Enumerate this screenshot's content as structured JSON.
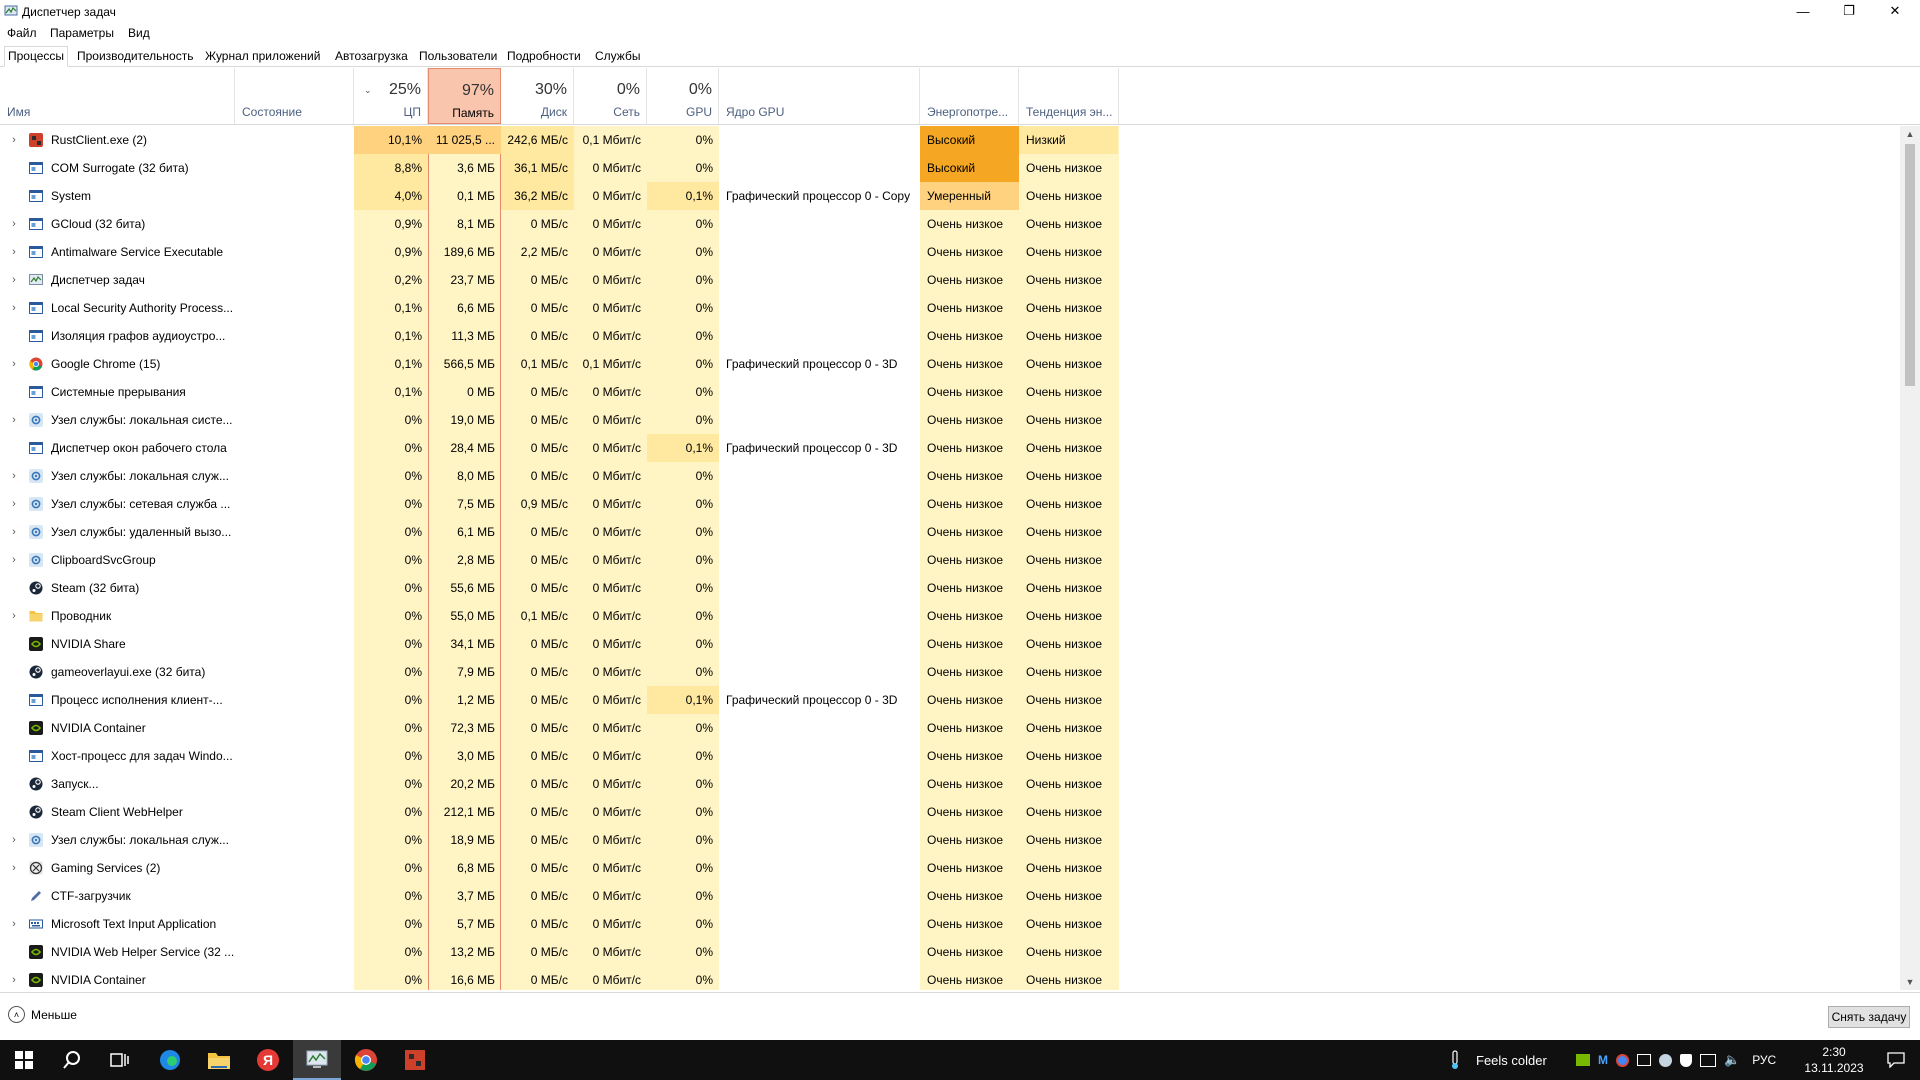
{
  "window": {
    "title": "Диспетчер задач"
  },
  "menu": [
    "Файл",
    "Параметры",
    "Вид"
  ],
  "tabs": [
    "Процессы",
    "Производительность",
    "Журнал приложений",
    "Автозагрузка",
    "Пользователи",
    "Подробности",
    "Службы"
  ],
  "header": {
    "name": "Имя",
    "status": "Состояние",
    "cpu_pct": "25%",
    "cpu": "ЦП",
    "mem_pct": "97%",
    "mem": "Память",
    "disk_pct": "30%",
    "disk": "Диск",
    "net_pct": "0%",
    "net": "Сеть",
    "gpu_pct": "0%",
    "gpu": "GPU",
    "gpu_engine": "Ядро GPU",
    "power": "Энергопотре...",
    "power_trend": "Тенденция эн..."
  },
  "colors": {
    "heat_light": "#fff4c4",
    "heat_mid": "#ffe8a0",
    "mem_heat": "#ffd27f",
    "power_high": "#f5a623",
    "power_medium": "#ffd27f",
    "mem_header": "#f9c5ad"
  },
  "rows": [
    {
      "exp": true,
      "icon": "rust-icon",
      "name": "RustClient.exe (2)",
      "cpu": "10,1%",
      "mem": "11 025,5 ...",
      "disk": "242,6 МБ/с",
      "net": "0,1 Мбит/с",
      "gpu": "0%",
      "engine": "",
      "power": "Высокий",
      "trend": "Низкий",
      "pl": "high",
      "tl": "low",
      "heat": 3
    },
    {
      "exp": false,
      "icon": "window-icon",
      "name": "COM Surrogate (32 бита)",
      "cpu": "8,8%",
      "mem": "3,6 МБ",
      "disk": "36,1 МБ/с",
      "net": "0 Мбит/с",
      "gpu": "0%",
      "engine": "",
      "power": "Высокий",
      "trend": "Очень низкое",
      "pl": "high",
      "tl": "",
      "heat": 2
    },
    {
      "exp": false,
      "icon": "window-icon",
      "name": "System",
      "cpu": "4,0%",
      "mem": "0,1 МБ",
      "disk": "36,2 МБ/с",
      "net": "0 Мбит/с",
      "gpu": "0,1%",
      "engine": "Графический процессор 0 - Copy",
      "power": "Умеренный",
      "trend": "Очень низкое",
      "pl": "mid",
      "tl": "",
      "heat": 2
    },
    {
      "exp": true,
      "icon": "window-icon",
      "name": "GCloud (32 бита)",
      "cpu": "0,9%",
      "mem": "8,1 МБ",
      "disk": "0 МБ/с",
      "net": "0 Мбит/с",
      "gpu": "0%",
      "engine": "",
      "power": "Очень низкое",
      "trend": "Очень низкое",
      "pl": "",
      "tl": "",
      "heat": 1
    },
    {
      "exp": true,
      "icon": "window-icon",
      "name": "Antimalware Service Executable",
      "cpu": "0,9%",
      "mem": "189,6 МБ",
      "disk": "2,2 МБ/с",
      "net": "0 Мбит/с",
      "gpu": "0%",
      "engine": "",
      "power": "Очень низкое",
      "trend": "Очень низкое",
      "pl": "",
      "tl": "",
      "heat": 1
    },
    {
      "exp": true,
      "icon": "taskmgr-icon",
      "name": "Диспетчер задач",
      "cpu": "0,2%",
      "mem": "23,7 МБ",
      "disk": "0 МБ/с",
      "net": "0 Мбит/с",
      "gpu": "0%",
      "engine": "",
      "power": "Очень низкое",
      "trend": "Очень низкое",
      "pl": "",
      "tl": "",
      "heat": 1
    },
    {
      "exp": true,
      "icon": "window-icon",
      "name": "Local Security Authority Process...",
      "cpu": "0,1%",
      "mem": "6,6 МБ",
      "disk": "0 МБ/с",
      "net": "0 Мбит/с",
      "gpu": "0%",
      "engine": "",
      "power": "Очень низкое",
      "trend": "Очень низкое",
      "pl": "",
      "tl": "",
      "heat": 1
    },
    {
      "exp": false,
      "icon": "window-icon",
      "name": "Изоляция графов аудиоустро...",
      "cpu": "0,1%",
      "mem": "11,3 МБ",
      "disk": "0 МБ/с",
      "net": "0 Мбит/с",
      "gpu": "0%",
      "engine": "",
      "power": "Очень низкое",
      "trend": "Очень низкое",
      "pl": "",
      "tl": "",
      "heat": 1
    },
    {
      "exp": true,
      "icon": "chrome-icon",
      "name": "Google Chrome (15)",
      "cpu": "0,1%",
      "mem": "566,5 МБ",
      "disk": "0,1 МБ/с",
      "net": "0,1 Мбит/с",
      "gpu": "0%",
      "engine": "Графический процессор 0 - 3D",
      "power": "Очень низкое",
      "trend": "Очень низкое",
      "pl": "",
      "tl": "",
      "heat": 1
    },
    {
      "exp": false,
      "icon": "window-icon",
      "name": "Системные прерывания",
      "cpu": "0,1%",
      "mem": "0 МБ",
      "disk": "0 МБ/с",
      "net": "0 Мбит/с",
      "gpu": "0%",
      "engine": "",
      "power": "Очень низкое",
      "trend": "Очень низкое",
      "pl": "",
      "tl": "",
      "heat": 1
    },
    {
      "exp": true,
      "icon": "gear-icon",
      "name": "Узел службы: локальная систе...",
      "cpu": "0%",
      "mem": "19,0 МБ",
      "disk": "0 МБ/с",
      "net": "0 Мбит/с",
      "gpu": "0%",
      "engine": "",
      "power": "Очень низкое",
      "trend": "Очень низкое",
      "pl": "",
      "tl": "",
      "heat": 0
    },
    {
      "exp": false,
      "icon": "window-icon",
      "name": "Диспетчер окон рабочего стола",
      "cpu": "0%",
      "mem": "28,4 МБ",
      "disk": "0 МБ/с",
      "net": "0 Мбит/с",
      "gpu": "0,1%",
      "engine": "Графический процессор 0 - 3D",
      "power": "Очень низкое",
      "trend": "Очень низкое",
      "pl": "",
      "tl": "",
      "heat": 0
    },
    {
      "exp": true,
      "icon": "gear-icon",
      "name": "Узел службы: локальная служ...",
      "cpu": "0%",
      "mem": "8,0 МБ",
      "disk": "0 МБ/с",
      "net": "0 Мбит/с",
      "gpu": "0%",
      "engine": "",
      "power": "Очень низкое",
      "trend": "Очень низкое",
      "pl": "",
      "tl": "",
      "heat": 0
    },
    {
      "exp": true,
      "icon": "gear-icon",
      "name": "Узел службы: сетевая служба ...",
      "cpu": "0%",
      "mem": "7,5 МБ",
      "disk": "0,9 МБ/с",
      "net": "0 Мбит/с",
      "gpu": "0%",
      "engine": "",
      "power": "Очень низкое",
      "trend": "Очень низкое",
      "pl": "",
      "tl": "",
      "heat": 0
    },
    {
      "exp": true,
      "icon": "gear-icon",
      "name": "Узел службы: удаленный вызо...",
      "cpu": "0%",
      "mem": "6,1 МБ",
      "disk": "0 МБ/с",
      "net": "0 Мбит/с",
      "gpu": "0%",
      "engine": "",
      "power": "Очень низкое",
      "trend": "Очень низкое",
      "pl": "",
      "tl": "",
      "heat": 0
    },
    {
      "exp": true,
      "icon": "gear-icon",
      "name": "ClipboardSvcGroup",
      "cpu": "0%",
      "mem": "2,8 МБ",
      "disk": "0 МБ/с",
      "net": "0 Мбит/с",
      "gpu": "0%",
      "engine": "",
      "power": "Очень низкое",
      "trend": "Очень низкое",
      "pl": "",
      "tl": "",
      "heat": 0
    },
    {
      "exp": false,
      "icon": "steam-icon",
      "name": "Steam (32 бита)",
      "cpu": "0%",
      "mem": "55,6 МБ",
      "disk": "0 МБ/с",
      "net": "0 Мбит/с",
      "gpu": "0%",
      "engine": "",
      "power": "Очень низкое",
      "trend": "Очень низкое",
      "pl": "",
      "tl": "",
      "heat": 0
    },
    {
      "exp": true,
      "icon": "folder-icon",
      "name": "Проводник",
      "cpu": "0%",
      "mem": "55,0 МБ",
      "disk": "0,1 МБ/с",
      "net": "0 Мбит/с",
      "gpu": "0%",
      "engine": "",
      "power": "Очень низкое",
      "trend": "Очень низкое",
      "pl": "",
      "tl": "",
      "heat": 0
    },
    {
      "exp": false,
      "icon": "nvidia-icon",
      "name": "NVIDIA Share",
      "cpu": "0%",
      "mem": "34,1 МБ",
      "disk": "0 МБ/с",
      "net": "0 Мбит/с",
      "gpu": "0%",
      "engine": "",
      "power": "Очень низкое",
      "trend": "Очень низкое",
      "pl": "",
      "tl": "",
      "heat": 0
    },
    {
      "exp": false,
      "icon": "steam-icon",
      "name": "gameoverlayui.exe (32 бита)",
      "cpu": "0%",
      "mem": "7,9 МБ",
      "disk": "0 МБ/с",
      "net": "0 Мбит/с",
      "gpu": "0%",
      "engine": "",
      "power": "Очень низкое",
      "trend": "Очень низкое",
      "pl": "",
      "tl": "",
      "heat": 0
    },
    {
      "exp": false,
      "icon": "window-icon",
      "name": "Процесс исполнения клиент-...",
      "cpu": "0%",
      "mem": "1,2 МБ",
      "disk": "0 МБ/с",
      "net": "0 Мбит/с",
      "gpu": "0,1%",
      "engine": "Графический процессор 0 - 3D",
      "power": "Очень низкое",
      "trend": "Очень низкое",
      "pl": "",
      "tl": "",
      "heat": 0
    },
    {
      "exp": false,
      "icon": "nvidia-icon",
      "name": "NVIDIA Container",
      "cpu": "0%",
      "mem": "72,3 МБ",
      "disk": "0 МБ/с",
      "net": "0 Мбит/с",
      "gpu": "0%",
      "engine": "",
      "power": "Очень низкое",
      "trend": "Очень низкое",
      "pl": "",
      "tl": "",
      "heat": 0
    },
    {
      "exp": false,
      "icon": "window-icon",
      "name": "Хост-процесс для задач Windo...",
      "cpu": "0%",
      "mem": "3,0 МБ",
      "disk": "0 МБ/с",
      "net": "0 Мбит/с",
      "gpu": "0%",
      "engine": "",
      "power": "Очень низкое",
      "trend": "Очень низкое",
      "pl": "",
      "tl": "",
      "heat": 0
    },
    {
      "exp": false,
      "icon": "steam-icon",
      "name": "Запуск...",
      "cpu": "0%",
      "mem": "20,2 МБ",
      "disk": "0 МБ/с",
      "net": "0 Мбит/с",
      "gpu": "0%",
      "engine": "",
      "power": "Очень низкое",
      "trend": "Очень низкое",
      "pl": "",
      "tl": "",
      "heat": 0
    },
    {
      "exp": false,
      "icon": "steam-icon",
      "name": "Steam Client WebHelper",
      "cpu": "0%",
      "mem": "212,1 МБ",
      "disk": "0 МБ/с",
      "net": "0 Мбит/с",
      "gpu": "0%",
      "engine": "",
      "power": "Очень низкое",
      "trend": "Очень низкое",
      "pl": "",
      "tl": "",
      "heat": 0
    },
    {
      "exp": true,
      "icon": "gear-icon",
      "name": "Узел службы: локальная служ...",
      "cpu": "0%",
      "mem": "18,9 МБ",
      "disk": "0 МБ/с",
      "net": "0 Мбит/с",
      "gpu": "0%",
      "engine": "",
      "power": "Очень низкое",
      "trend": "Очень низкое",
      "pl": "",
      "tl": "",
      "heat": 0
    },
    {
      "exp": true,
      "icon": "xbox-icon",
      "name": "Gaming Services (2)",
      "cpu": "0%",
      "mem": "6,8 МБ",
      "disk": "0 МБ/с",
      "net": "0 Мбит/с",
      "gpu": "0%",
      "engine": "",
      "power": "Очень низкое",
      "trend": "Очень низкое",
      "pl": "",
      "tl": "",
      "heat": 0
    },
    {
      "exp": false,
      "icon": "pen-icon",
      "name": "CTF-загрузчик",
      "cpu": "0%",
      "mem": "3,7 МБ",
      "disk": "0 МБ/с",
      "net": "0 Мбит/с",
      "gpu": "0%",
      "engine": "",
      "power": "Очень низкое",
      "trend": "Очень низкое",
      "pl": "",
      "tl": "",
      "heat": 0
    },
    {
      "exp": true,
      "icon": "keyboard-icon",
      "name": "Microsoft Text Input Application",
      "cpu": "0%",
      "mem": "5,7 МБ",
      "disk": "0 МБ/с",
      "net": "0 Мбит/с",
      "gpu": "0%",
      "engine": "",
      "power": "Очень низкое",
      "trend": "Очень низкое",
      "pl": "",
      "tl": "",
      "heat": 0
    },
    {
      "exp": false,
      "icon": "nvidia-icon",
      "name": "NVIDIA Web Helper Service (32 ...",
      "cpu": "0%",
      "mem": "13,2 МБ",
      "disk": "0 МБ/с",
      "net": "0 Мбит/с",
      "gpu": "0%",
      "engine": "",
      "power": "Очень низкое",
      "trend": "Очень низкое",
      "pl": "",
      "tl": "",
      "heat": 0
    },
    {
      "exp": true,
      "icon": "nvidia-icon",
      "name": "NVIDIA Container",
      "cpu": "0%",
      "mem": "16,6 МБ",
      "disk": "0 МБ/с",
      "net": "0 Мбит/с",
      "gpu": "0%",
      "engine": "",
      "power": "Очень низкое",
      "trend": "Очень низкое",
      "pl": "",
      "tl": "",
      "heat": 0
    }
  ],
  "footer": {
    "less": "Меньше",
    "end_task": "Снять задачу"
  },
  "taskbar": {
    "weather": "Feels colder",
    "lang": "РУС",
    "time": "2:30",
    "date": "13.11.2023"
  }
}
